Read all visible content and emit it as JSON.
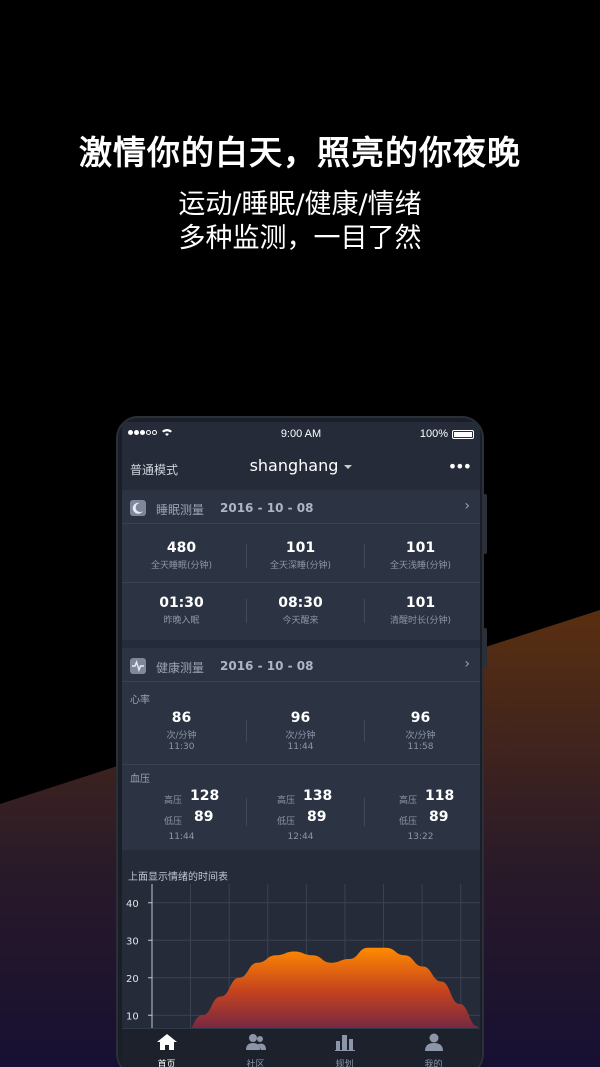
{
  "promo": {
    "headline": "激情你的白天，照亮的你夜晚",
    "subline1": "运动/睡眠/健康/情绪",
    "subline2": "多种监测，一目了然"
  },
  "status_bar": {
    "time": "9:00 AM",
    "battery": "100%"
  },
  "nav": {
    "mode": "普通模式",
    "account": "shanghang",
    "more": "•••"
  },
  "sleep": {
    "title": "睡眠测量",
    "date": "2016 - 10  - 08",
    "metrics": [
      {
        "value": "480",
        "label": "全天睡眠(分钟)"
      },
      {
        "value": "101",
        "label": "全天深睡(分钟)"
      },
      {
        "value": "101",
        "label": "全天浅睡(分钟)"
      },
      {
        "value": "01:30",
        "label": "昨晚入眠"
      },
      {
        "value": "08:30",
        "label": "今天醒来"
      },
      {
        "value": "101",
        "label": "清醒时长(分钟)"
      }
    ]
  },
  "health": {
    "title": "健康测量",
    "date": "2016 - 10  - 08",
    "heart_label": "心率",
    "heart": [
      {
        "value": "86",
        "unit": "次/分钟",
        "time": "11:30"
      },
      {
        "value": "96",
        "unit": "次/分钟",
        "time": "11:44"
      },
      {
        "value": "96",
        "unit": "次/分钟",
        "time": "11:58"
      }
    ],
    "bp_label": "血压",
    "high_label": "高压",
    "low_label": "低压",
    "bp": [
      {
        "high": "128",
        "low": "89",
        "time": "11:44"
      },
      {
        "high": "138",
        "low": "89",
        "time": "12:44"
      },
      {
        "high": "118",
        "low": "89",
        "time": "13:22"
      }
    ]
  },
  "mood_chart": {
    "title": "上面显示情绪的时间表"
  },
  "chart_data": {
    "type": "area",
    "title": "上面显示情绪的时间表",
    "ytick_labels": [
      "40",
      "30",
      "20",
      "10"
    ],
    "ylim": [
      5,
      45
    ],
    "x": [
      0,
      1,
      2,
      3,
      4,
      5,
      6,
      7,
      8,
      9,
      10,
      11,
      12,
      13,
      14,
      15,
      16
    ],
    "values": [
      5,
      10,
      15,
      20,
      24,
      26,
      27,
      26,
      24,
      25,
      28,
      28,
      26,
      23,
      19,
      13,
      7
    ],
    "grid": true,
    "colors": [
      "#ff8a00",
      "#6a2448"
    ]
  },
  "tabs": [
    {
      "label": "首页",
      "icon": "home-icon",
      "active": true
    },
    {
      "label": "社区",
      "icon": "community-icon",
      "active": false
    },
    {
      "label": "规划",
      "icon": "plan-icon",
      "active": false
    },
    {
      "label": "我的",
      "icon": "profile-icon",
      "active": false
    }
  ],
  "colors": {
    "background": "#000000",
    "accent_orange": "#ff8a00",
    "card": "#2c3343"
  }
}
